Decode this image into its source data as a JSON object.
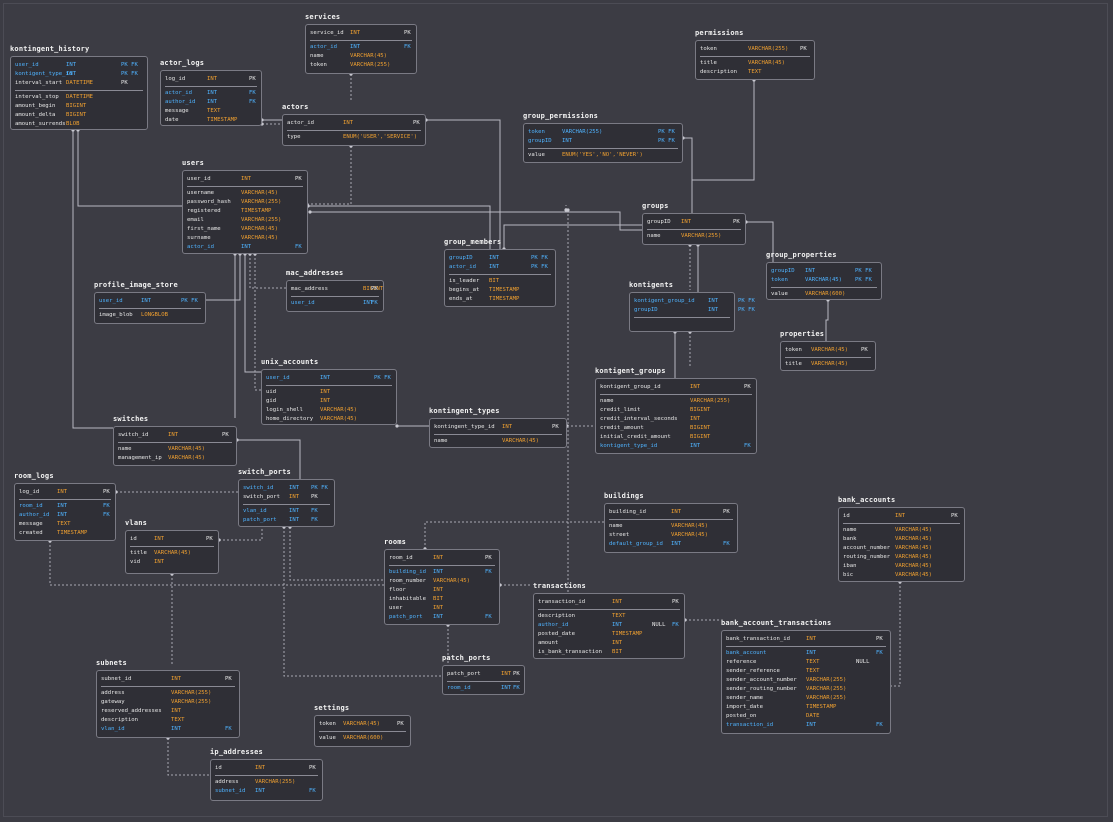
{
  "tables": [
    {
      "id": "kontingent_history",
      "title": "kontingent_history",
      "rows": [
        {
          "n": "user_id",
          "t": "INT",
          "f": "PK FK",
          "k": true
        },
        {
          "n": "kontigent_type_id",
          "t": "INT",
          "f": "PK FK",
          "k": true
        },
        {
          "n": "interval_start",
          "t": "DATETIME",
          "f": "PK"
        },
        {
          "sep": true
        },
        {
          "n": "interval_stop",
          "t": "DATETIME"
        },
        {
          "n": "amount_begin",
          "t": "BIGINT"
        },
        {
          "n": "amount_delta",
          "t": "BIGINT"
        },
        {
          "n": "amount_surrends",
          "t": "BLOB"
        }
      ]
    },
    {
      "id": "actor_logs",
      "title": "actor_logs",
      "rows": [
        {
          "n": "log_id",
          "t": "INT",
          "f": "PK"
        },
        {
          "sep": true
        },
        {
          "n": "actor_id",
          "t": "INT",
          "f": "FK",
          "k": true
        },
        {
          "n": "author_id",
          "t": "INT",
          "f": "FK",
          "k": true
        },
        {
          "n": "message",
          "t": "TEXT"
        },
        {
          "n": "date",
          "t": "TIMESTAMP"
        }
      ]
    },
    {
      "id": "services",
      "title": "services",
      "rows": [
        {
          "n": "service_id",
          "t": "INT",
          "f": "PK"
        },
        {
          "sep": true
        },
        {
          "n": "actor_id",
          "t": "INT",
          "f": "FK",
          "k": true
        },
        {
          "n": "name",
          "t": "VARCHAR(45)"
        },
        {
          "n": "token",
          "t": "VARCHAR(255)"
        }
      ]
    },
    {
      "id": "permissions",
      "title": "permissions",
      "rows": [
        {
          "n": "token",
          "t": "VARCHAR(255)",
          "f": "PK"
        },
        {
          "sep": true
        },
        {
          "n": "title",
          "t": "VARCHAR(45)"
        },
        {
          "n": "description",
          "t": "TEXT"
        }
      ]
    },
    {
      "id": "actors",
      "title": "actors",
      "rows": [
        {
          "n": "actor_id",
          "t": "INT",
          "f": "PK"
        },
        {
          "sep": true
        },
        {
          "n": "type",
          "t": "ENUM('USER','SERVICE')"
        }
      ]
    },
    {
      "id": "group_permissions",
      "title": "group_permissions",
      "rows": [
        {
          "n": "token",
          "t": "VARCHAR(255)",
          "f": "PK FK",
          "k": true
        },
        {
          "n": "groupID",
          "t": "INT",
          "f": "PK FK",
          "k": true
        },
        {
          "sep": true
        },
        {
          "n": "value",
          "t": "ENUM('YES','NO','NEVER')"
        }
      ]
    },
    {
      "id": "users",
      "title": "users",
      "rows": [
        {
          "n": "user_id",
          "t": "INT",
          "f": "PK"
        },
        {
          "sep": true
        },
        {
          "n": "username",
          "t": "VARCHAR(45)"
        },
        {
          "n": "password_hash",
          "t": "VARCHAR(255)"
        },
        {
          "n": "registered",
          "t": "TIMESTAMP"
        },
        {
          "n": "email",
          "t": "VARCHAR(255)"
        },
        {
          "n": "first_name",
          "t": "VARCHAR(45)"
        },
        {
          "n": "surname",
          "t": "VARCHAR(45)"
        },
        {
          "n": "actor_id",
          "t": "INT",
          "f": "FK",
          "k": true
        }
      ]
    },
    {
      "id": "groups",
      "title": "groups",
      "rows": [
        {
          "n": "groupID",
          "t": "INT",
          "f": "PK"
        },
        {
          "sep": true
        },
        {
          "n": "name",
          "t": "VARCHAR(255)"
        }
      ]
    },
    {
      "id": "group_members",
      "title": "group_members",
      "rows": [
        {
          "n": "groupID",
          "t": "INT",
          "f": "PK FK",
          "k": true
        },
        {
          "n": "actor_id",
          "t": "INT",
          "f": "PK FK",
          "k": true
        },
        {
          "sep": true
        },
        {
          "n": "is_leader",
          "t": "BIT"
        },
        {
          "n": "begins_at",
          "t": "TIMESTAMP"
        },
        {
          "n": "ends_at",
          "t": "TIMESTAMP"
        }
      ]
    },
    {
      "id": "group_properties",
      "title": "group_properties",
      "rows": [
        {
          "n": "groupID",
          "t": "INT",
          "f": "PK FK",
          "k": true
        },
        {
          "n": "token",
          "t": "VARCHAR(45)",
          "f": "PK FK",
          "k": true
        },
        {
          "sep": true
        },
        {
          "n": "value",
          "t": "VARCHAR(600)"
        }
      ]
    },
    {
      "id": "profile_image_store",
      "title": "profile_image_store",
      "rows": [
        {
          "n": "user_id",
          "t": "INT",
          "f": "PK FK",
          "k": true
        },
        {
          "sep": true
        },
        {
          "n": "image_blob",
          "t": "LONGBLOB"
        }
      ]
    },
    {
      "id": "mac_addresses",
      "title": "mac_addresses",
      "rows": [
        {
          "n": "mac_address",
          "t": "BIGINT",
          "f": "PK"
        },
        {
          "sep": true
        },
        {
          "n": "user_id",
          "t": "INT",
          "f": "FK",
          "k": true
        }
      ]
    },
    {
      "id": "kontigents",
      "title": "kontigents",
      "rows": [
        {
          "n": "kontigent_group_id",
          "t": "INT",
          "f": "PK FK",
          "k": true
        },
        {
          "n": "groupID",
          "t": "INT",
          "f": "PK FK",
          "k": true
        },
        {
          "sep": true
        }
      ]
    },
    {
      "id": "properties",
      "title": "properties",
      "rows": [
        {
          "n": "token",
          "t": "VARCHAR(45)",
          "f": "PK"
        },
        {
          "sep": true
        },
        {
          "n": "title",
          "t": "VARCHAR(45)"
        }
      ]
    },
    {
      "id": "unix_accounts",
      "title": "unix_accounts",
      "rows": [
        {
          "n": "user_id",
          "t": "INT",
          "f": "PK FK",
          "k": true
        },
        {
          "sep": true
        },
        {
          "n": "uid",
          "t": "INT"
        },
        {
          "n": "gid",
          "t": "INT"
        },
        {
          "n": "login_shell",
          "t": "VARCHAR(45)"
        },
        {
          "n": "home_directory",
          "t": "VARCHAR(45)"
        }
      ]
    },
    {
      "id": "kontigent_groups",
      "title": "kontigent_groups",
      "rows": [
        {
          "n": "kontigent_group_id",
          "t": "INT",
          "f": "PK"
        },
        {
          "sep": true
        },
        {
          "n": "name",
          "t": "VARCHAR(255)"
        },
        {
          "n": "credit_limit",
          "t": "BIGINT"
        },
        {
          "n": "credit_interval_seconds",
          "t": "INT"
        },
        {
          "n": "credit_amount",
          "t": "BIGINT"
        },
        {
          "n": "initial_credit_amount",
          "t": "BIGINT"
        },
        {
          "n": "kontigent_type_id",
          "t": "INT",
          "f": "FK",
          "k": true
        }
      ]
    },
    {
      "id": "switches",
      "title": "switches",
      "rows": [
        {
          "n": "switch_id",
          "t": "INT",
          "f": "PK"
        },
        {
          "sep": true
        },
        {
          "n": "name",
          "t": "VARCHAR(45)"
        },
        {
          "n": "management_ip",
          "t": "VARCHAR(45)"
        }
      ]
    },
    {
      "id": "kontingent_types",
      "title": "kontingent_types",
      "rows": [
        {
          "n": "kontingent_type_id",
          "t": "INT",
          "f": "PK"
        },
        {
          "sep": true
        },
        {
          "n": "name",
          "t": "VARCHAR(45)"
        }
      ]
    },
    {
      "id": "room_logs",
      "title": "room_logs",
      "rows": [
        {
          "n": "log_id",
          "t": "INT",
          "f": "PK"
        },
        {
          "sep": true
        },
        {
          "n": "room_id",
          "t": "INT",
          "f": "FK",
          "k": true
        },
        {
          "n": "author_id",
          "t": "INT",
          "f": "FK",
          "k": true
        },
        {
          "n": "message",
          "t": "TEXT"
        },
        {
          "n": "created",
          "t": "TIMESTAMP"
        }
      ]
    },
    {
      "id": "switch_ports",
      "title": "switch_ports",
      "rows": [
        {
          "n": "switch_id",
          "t": "INT",
          "f": "PK FK",
          "k": true
        },
        {
          "n": "switch_port",
          "t": "INT",
          "f": "PK"
        },
        {
          "sep": true
        },
        {
          "n": "vlan_id",
          "t": "INT",
          "f": "FK",
          "k": true
        },
        {
          "n": "patch_port",
          "t": "INT",
          "f": "FK",
          "k": true
        }
      ]
    },
    {
      "id": "buildings",
      "title": "buildings",
      "rows": [
        {
          "n": "building_id",
          "t": "INT",
          "f": "PK"
        },
        {
          "sep": true
        },
        {
          "n": "name",
          "t": "VARCHAR(45)"
        },
        {
          "n": "street",
          "t": "VARCHAR(45)"
        },
        {
          "n": "default_group_id",
          "t": "INT",
          "f": "FK",
          "k": true
        }
      ]
    },
    {
      "id": "bank_accounts",
      "title": "bank_accounts",
      "rows": [
        {
          "n": "id",
          "t": "INT",
          "f": "PK"
        },
        {
          "sep": true
        },
        {
          "n": "name",
          "t": "VARCHAR(45)"
        },
        {
          "n": "bank",
          "t": "VARCHAR(45)"
        },
        {
          "n": "account_number",
          "t": "VARCHAR(45)"
        },
        {
          "n": "routing_number",
          "t": "VARCHAR(45)"
        },
        {
          "n": "iban",
          "t": "VARCHAR(45)"
        },
        {
          "n": "bic",
          "t": "VARCHAR(45)"
        }
      ]
    },
    {
      "id": "vlans",
      "title": "vlans",
      "rows": [
        {
          "n": "id",
          "t": "INT",
          "f": "PK"
        },
        {
          "sep": true
        },
        {
          "n": "title",
          "t": "VARCHAR(45)"
        },
        {
          "n": "vid",
          "t": "INT"
        }
      ]
    },
    {
      "id": "rooms",
      "title": "rooms",
      "rows": [
        {
          "n": "room_id",
          "t": "INT",
          "f": "PK"
        },
        {
          "sep": true
        },
        {
          "n": "building_id",
          "t": "INT",
          "f": "FK",
          "k": true
        },
        {
          "n": "room_number",
          "t": "VARCHAR(45)"
        },
        {
          "n": "floor",
          "t": "INT"
        },
        {
          "n": "inhabitable",
          "t": "BIT"
        },
        {
          "n": "user",
          "t": "INT"
        },
        {
          "n": "patch_port",
          "t": "INT",
          "f": "FK",
          "k": true
        }
      ]
    },
    {
      "id": "transactions",
      "title": "transactions",
      "rows": [
        {
          "n": "transaction_id",
          "t": "INT",
          "f": "PK"
        },
        {
          "sep": true
        },
        {
          "n": "description",
          "t": "TEXT"
        },
        {
          "n": "author_id",
          "t": "INT",
          "x": "NULL",
          "f": "FK",
          "k": true
        },
        {
          "n": "posted_date",
          "t": "TIMESTAMP"
        },
        {
          "n": "amount",
          "t": "INT"
        },
        {
          "n": "is_bank_transaction",
          "t": "BIT"
        }
      ]
    },
    {
      "id": "bank_account_transactions",
      "title": "bank_account_transactions",
      "rows": [
        {
          "n": "bank_transaction_id",
          "t": "INT",
          "f": "PK"
        },
        {
          "sep": true
        },
        {
          "n": "bank_account",
          "t": "INT",
          "f": "FK",
          "k": true
        },
        {
          "n": "reference",
          "t": "TEXT",
          "x": "NULL"
        },
        {
          "n": "sender_reference",
          "t": "TEXT"
        },
        {
          "n": "sender_account_number",
          "t": "VARCHAR(255)"
        },
        {
          "n": "sender_routing_number",
          "t": "VARCHAR(255)"
        },
        {
          "n": "sender_name",
          "t": "VARCHAR(255)"
        },
        {
          "n": "import_date",
          "t": "TIMESTAMP"
        },
        {
          "n": "posted_on",
          "t": "DATE"
        },
        {
          "n": "transaction_id",
          "t": "INT",
          "f": "FK",
          "k": true
        }
      ]
    },
    {
      "id": "patch_ports",
      "title": "patch_ports",
      "rows": [
        {
          "n": "patch_port",
          "t": "INT",
          "f": "PK"
        },
        {
          "sep": true
        },
        {
          "n": "room_id",
          "t": "INT",
          "f": "FK",
          "k": true
        }
      ]
    },
    {
      "id": "subnets",
      "title": "subnets",
      "rows": [
        {
          "n": "subnet_id",
          "t": "INT",
          "f": "PK"
        },
        {
          "sep": true
        },
        {
          "n": "address",
          "t": "VARCHAR(255)"
        },
        {
          "n": "gateway",
          "t": "VARCHAR(255)"
        },
        {
          "n": "reserved_addresses",
          "t": "INT"
        },
        {
          "n": "description",
          "t": "TEXT"
        },
        {
          "n": "vlan_id",
          "t": "INT",
          "f": "FK",
          "k": true
        }
      ]
    },
    {
      "id": "settings",
      "title": "settings",
      "rows": [
        {
          "n": "token",
          "t": "VARCHAR(45)",
          "f": "PK"
        },
        {
          "sep": true
        },
        {
          "n": "value",
          "t": "VARCHAR(600)"
        }
      ]
    },
    {
      "id": "ip_addresses",
      "title": "ip_addresses",
      "rows": [
        {
          "n": "id",
          "t": "INT",
          "f": "PK"
        },
        {
          "sep": true
        },
        {
          "n": "address",
          "t": "VARCHAR(255)"
        },
        {
          "n": "subnet_id",
          "t": "INT",
          "f": "FK",
          "k": true
        }
      ]
    }
  ]
}
